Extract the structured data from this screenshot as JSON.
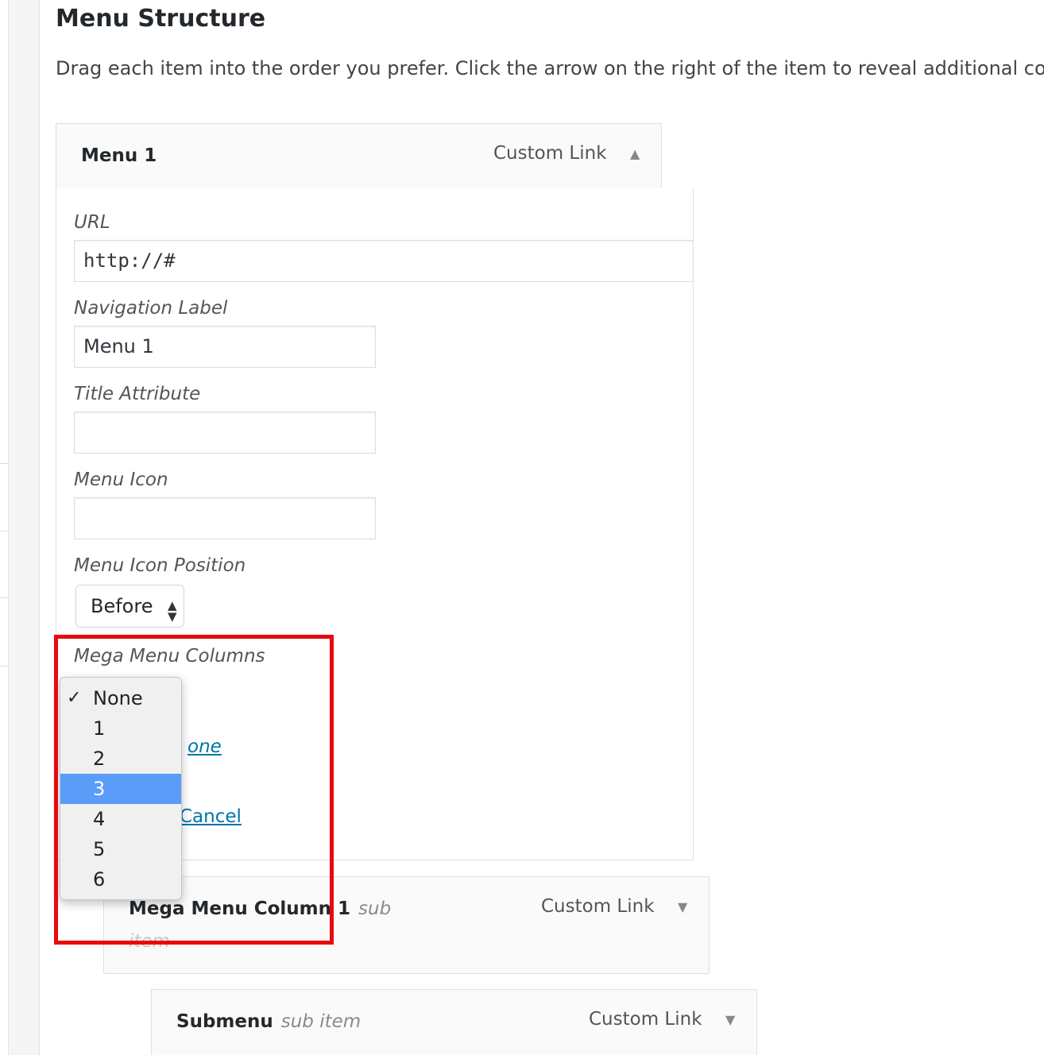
{
  "page": {
    "title": "Menu Structure",
    "description": "Drag each item into the order you prefer. Click the arrow on the right of the item to reveal additional co"
  },
  "menu_item": {
    "title": "Menu 1",
    "type": "Custom Link",
    "arrow_icon": "triangle-up-icon",
    "url_label": "URL",
    "url_value": "http://#",
    "nav_label_label": "Navigation Label",
    "nav_label_value": "Menu 1",
    "title_attr_label": "Title Attribute",
    "title_attr_value": "",
    "menu_icon_label": "Menu Icon",
    "menu_icon_value": "",
    "icon_position_label": "Menu Icon Position",
    "icon_position_value": "Before",
    "mega_columns_label": "Mega Menu Columns",
    "move_link_partial": "one",
    "cancel_partial": "Cancel"
  },
  "mega_columns_dropdown": {
    "check_glyph": "✓",
    "selected_option": "None",
    "highlighted_option": "3",
    "options": [
      "None",
      "1",
      "2",
      "3",
      "4",
      "5",
      "6"
    ]
  },
  "sub_items": [
    {
      "title": "Mega Menu Column 1",
      "sub_label": "sub",
      "overflow_text": "item",
      "type": "Custom Link",
      "arrow_icon": "triangle-down-icon"
    },
    {
      "title": "Submenu",
      "sub_label": "sub item",
      "type": "Custom Link",
      "arrow_icon": "triangle-down-icon"
    }
  ],
  "colors": {
    "highlight_border": "#e8090e",
    "selected_option_bg": "#5a9cf8",
    "link": "#0073aa"
  }
}
